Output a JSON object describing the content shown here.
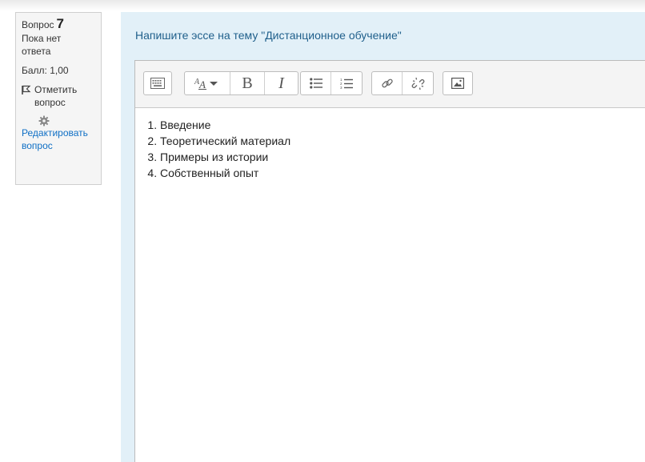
{
  "question_info": {
    "label": "Вопрос",
    "number": "7",
    "state_line1": "Пока нет",
    "state_line2": "ответа",
    "grade": "Балл: 1,00",
    "flag_label_line1": "Отметить",
    "flag_label_line2": "вопрос",
    "edit_label_line1": "Редактировать",
    "edit_label_line2": "вопрос"
  },
  "question_text": "Напишите эссе на тему \"Дистанционное обучение\"",
  "toolbar": {
    "bold_label": "B",
    "italic_label": "I"
  },
  "answer_items": [
    "Введение",
    "Теоретический материал",
    "Примеры из истории",
    "Собственный опыт"
  ],
  "colors": {
    "content_bg": "#e2f0f8",
    "link": "#0f6fc5",
    "question_text": "#1f5f8b"
  }
}
